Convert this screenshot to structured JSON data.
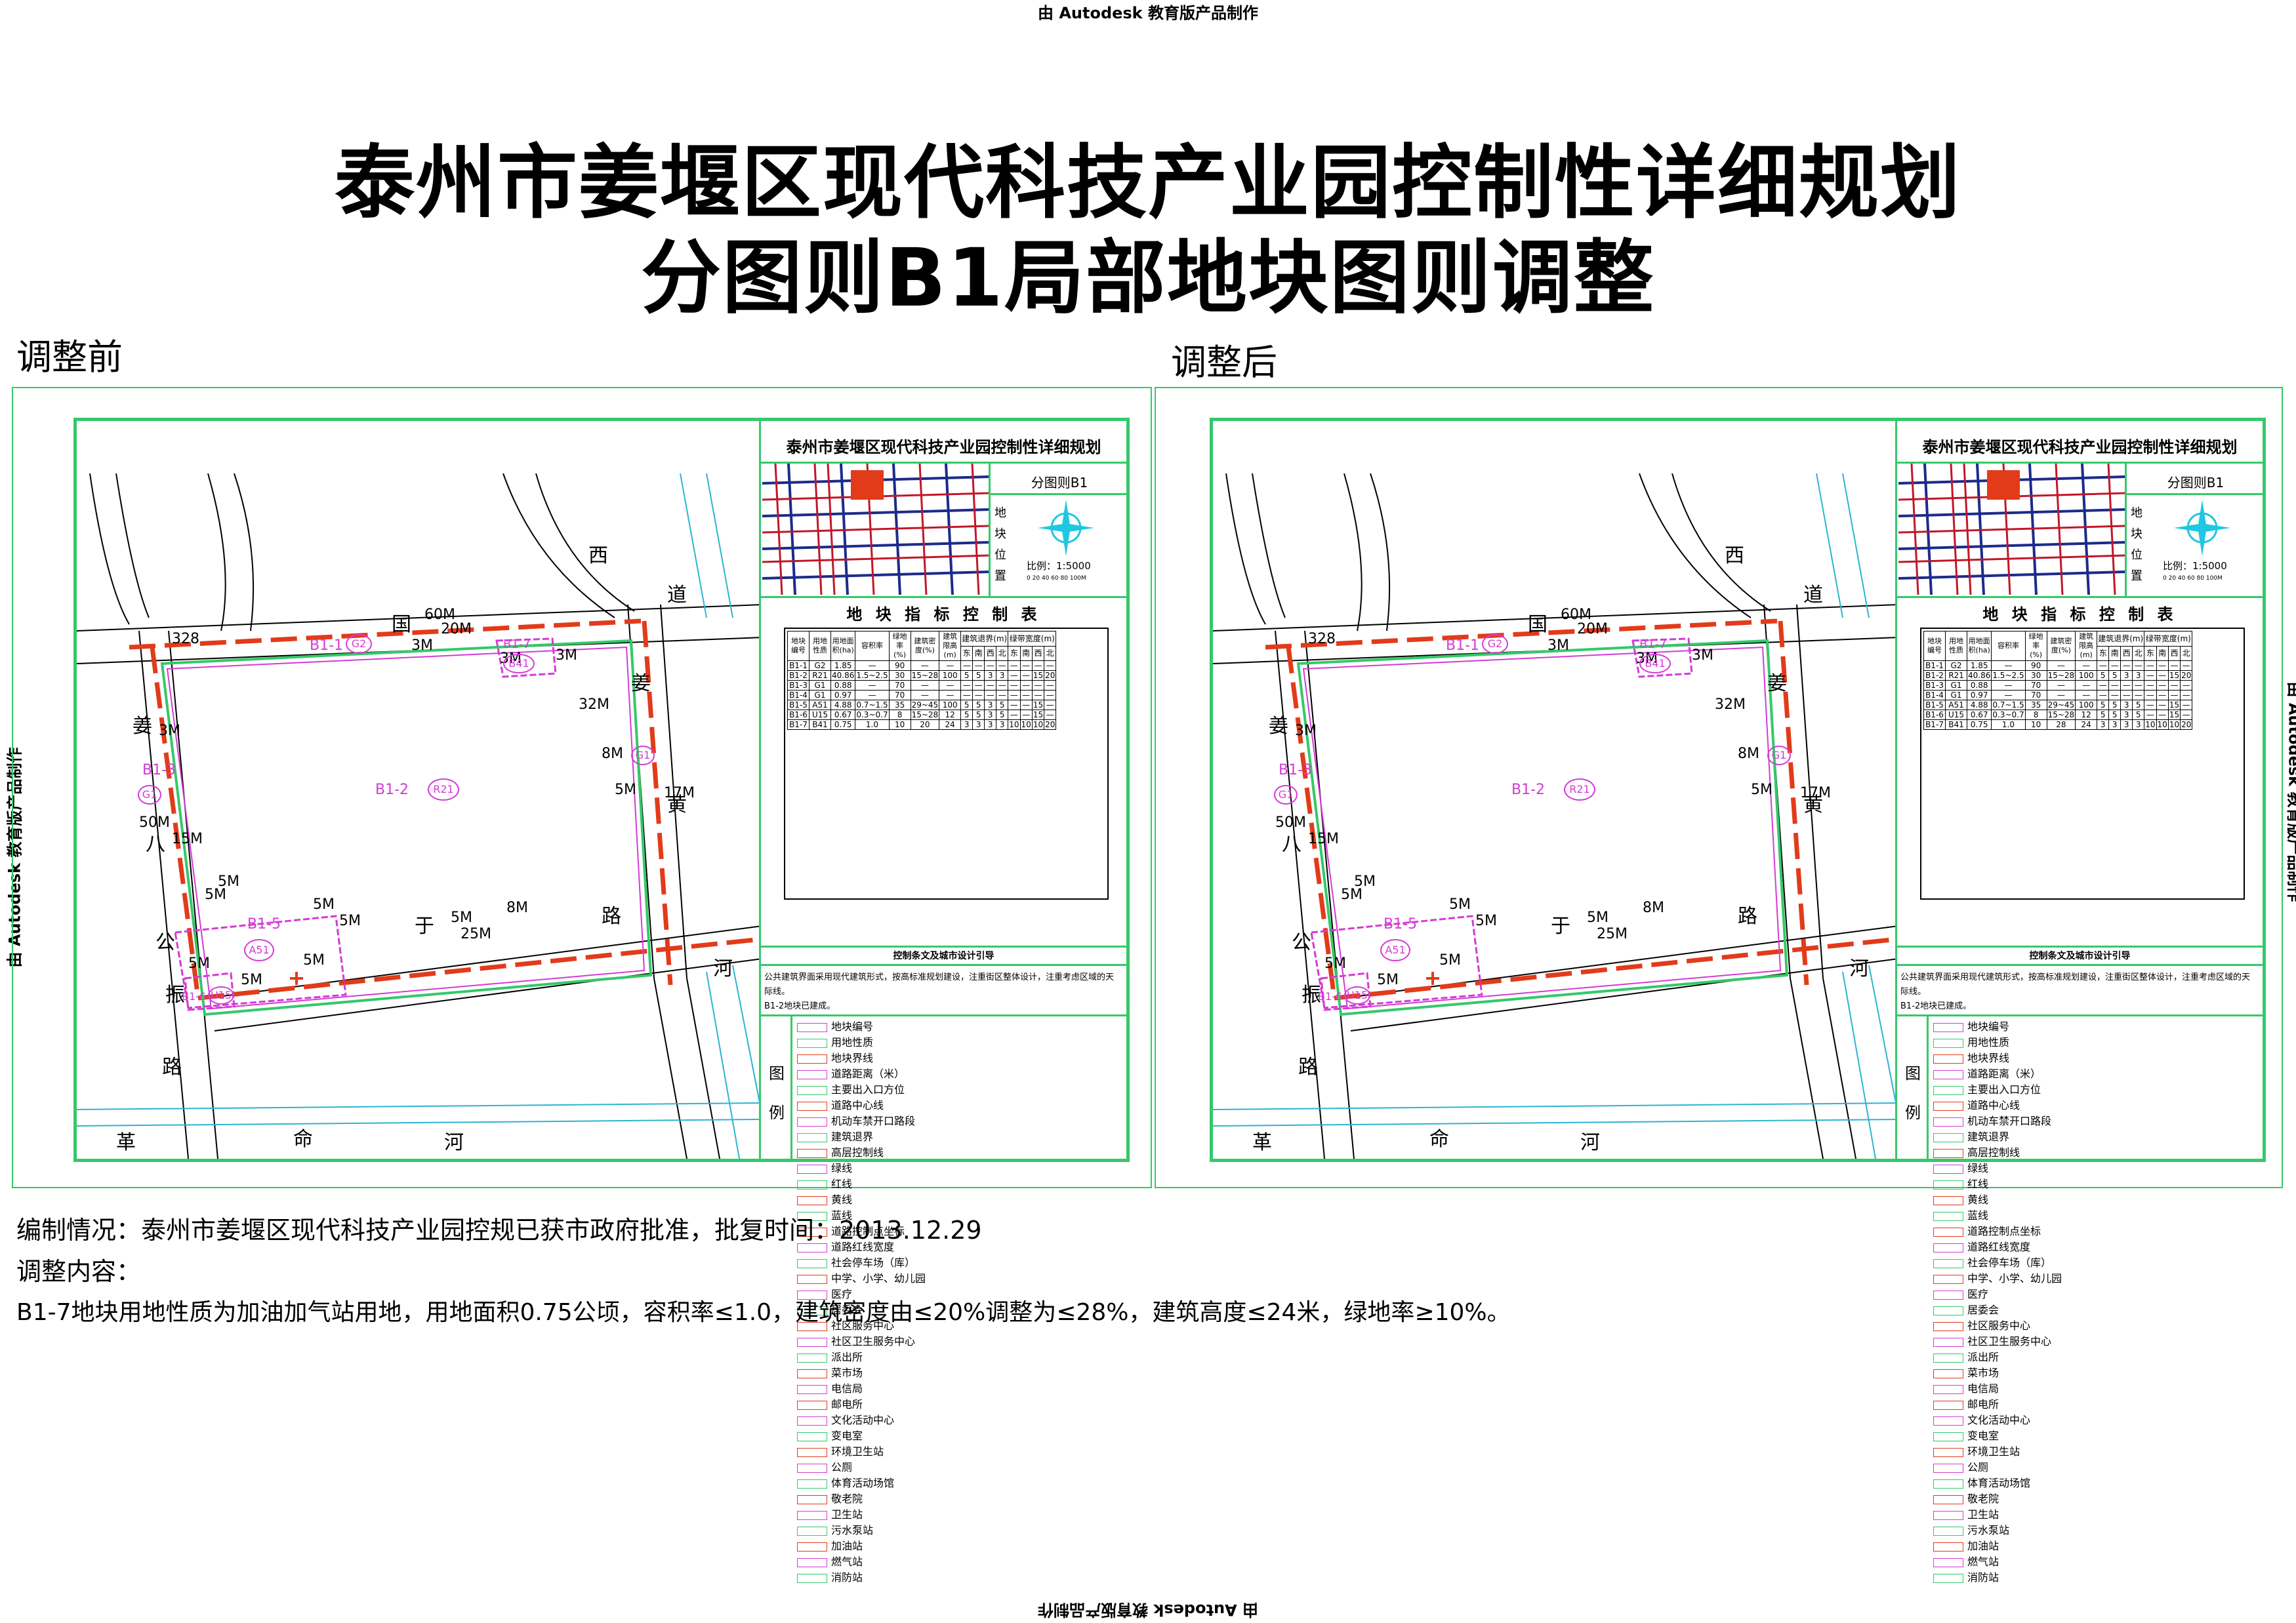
{
  "watermark": "由 Autodesk 教育版产品制作",
  "title_line1": "泰州市姜堰区现代科技产业园控制性详细规划",
  "title_line2": "分图则B1局部地块图则调整",
  "before_label": "调整前",
  "after_label": "调整后",
  "panel": {
    "plan_title": "泰州市姜堰区现代科技产业园控制性详细规划",
    "sheet_name": "分图则B1",
    "location_label": "地块位置",
    "scale": "比例：1:5000",
    "scale_ticks": "0  20  40  60  80  100M",
    "control_table_title": "地 块 指 标 控 制 表",
    "guide_title": "控制条文及城市设计引导",
    "guide_text_1": "公共建筑界面采用现代建筑形式，按高标准规划建设，注重街区整体设计，注重考虑区域的天际线。",
    "guide_text_2": "B1-2地块已建成。",
    "legend_title": "图例"
  },
  "table": {
    "headers": [
      "地块编号",
      "用地性质",
      "用地面积(ha)",
      "容积率",
      "绿地率(%)",
      "建筑密度(%)",
      "建筑限高(m)"
    ],
    "setback_header": "建筑退界(m)",
    "green_header": "绿带宽度(m)",
    "dirs": [
      "东",
      "南",
      "西",
      "北",
      "东",
      "南",
      "西",
      "北"
    ],
    "rows_before": [
      [
        "B1-1",
        "G2",
        "1.85",
        "—",
        "90",
        "—",
        "—",
        "—",
        "—",
        "—",
        "—",
        "—",
        "—",
        "—",
        "—"
      ],
      [
        "B1-2",
        "R21",
        "40.86",
        "1.5~2.5",
        "30",
        "15~28",
        "100",
        "5",
        "5",
        "3",
        "3",
        "—",
        "—",
        "15",
        "20"
      ],
      [
        "B1-3",
        "G1",
        "0.88",
        "—",
        "70",
        "—",
        "—",
        "—",
        "—",
        "—",
        "—",
        "—",
        "—",
        "—",
        "—"
      ],
      [
        "B1-4",
        "G1",
        "0.97",
        "—",
        "70",
        "—",
        "—",
        "—",
        "—",
        "—",
        "—",
        "—",
        "—",
        "—",
        "—"
      ],
      [
        "B1-5",
        "A51",
        "4.88",
        "0.7~1.5",
        "35",
        "29~45",
        "100",
        "5",
        "5",
        "3",
        "5",
        "—",
        "—",
        "15",
        "—"
      ],
      [
        "B1-6",
        "U15",
        "0.67",
        "0.3~0.7",
        "8",
        "15~28",
        "12",
        "5",
        "5",
        "3",
        "5",
        "—",
        "—",
        "15",
        "—"
      ],
      [
        "B1-7",
        "B41",
        "0.75",
        "1.0",
        "10",
        "20",
        "24",
        "3",
        "3",
        "3",
        "3",
        "10",
        "10",
        "10",
        "20"
      ]
    ],
    "rows_after": [
      [
        "B1-1",
        "G2",
        "1.85",
        "—",
        "90",
        "—",
        "—",
        "—",
        "—",
        "—",
        "—",
        "—",
        "—",
        "—",
        "—"
      ],
      [
        "B1-2",
        "R21",
        "40.86",
        "1.5~2.5",
        "30",
        "15~28",
        "100",
        "5",
        "5",
        "3",
        "3",
        "—",
        "—",
        "15",
        "20"
      ],
      [
        "B1-3",
        "G1",
        "0.88",
        "—",
        "70",
        "—",
        "—",
        "—",
        "—",
        "—",
        "—",
        "—",
        "—",
        "—",
        "—"
      ],
      [
        "B1-4",
        "G1",
        "0.97",
        "—",
        "70",
        "—",
        "—",
        "—",
        "—",
        "—",
        "—",
        "—",
        "—",
        "—",
        "—"
      ],
      [
        "B1-5",
        "A51",
        "4.88",
        "0.7~1.5",
        "35",
        "29~45",
        "100",
        "5",
        "5",
        "3",
        "5",
        "—",
        "—",
        "15",
        "—"
      ],
      [
        "B1-6",
        "U15",
        "0.67",
        "0.3~0.7",
        "8",
        "15~28",
        "12",
        "5",
        "5",
        "3",
        "5",
        "—",
        "—",
        "15",
        "—"
      ],
      [
        "B1-7",
        "B41",
        "0.75",
        "1.0",
        "10",
        "28",
        "24",
        "3",
        "3",
        "3",
        "3",
        "10",
        "10",
        "10",
        "20"
      ]
    ]
  },
  "legend": {
    "col1": [
      "地块编号",
      "用地性质",
      "地块界线",
      "道路距离（米）",
      "主要出入口方位",
      "道路中心线",
      "机动车禁开口路段",
      "建筑退界",
      "高层控制线",
      "绿线",
      "红线",
      "黄线"
    ],
    "col2": [
      "蓝线",
      "道路控制点坐标",
      "道路红线宽度",
      "社会停车场（库）",
      "中学、小学、幼儿园",
      "医疗",
      "居委会",
      "社区服务中心",
      "社区卫生服务中心",
      "派出所",
      "菜市场",
      "电信局"
    ],
    "col3": [
      "邮电所",
      "文化活动中心",
      "变电室",
      "环境卫生站",
      "公厕",
      "体育活动场馆",
      "敬老院",
      "卫生站",
      "污水泵站",
      "加油站",
      "燃气站",
      "消防站"
    ]
  },
  "map": {
    "roads": {
      "xi": "西",
      "dao": "道",
      "guo": "国",
      "n328": "328",
      "jiang_r1": "姜",
      "jiang_r2": "黄",
      "lu_r": "路",
      "jiang_l1": "姜",
      "jiang_l2": "八",
      "jiang_l3": "公",
      "jiang_l4": "振",
      "jiang_l5": "路",
      "yu": "于",
      "he_r": "河",
      "ge": "革",
      "ming": "命",
      "he_b": "河"
    },
    "dims": {
      "d60m_top": "60M",
      "d20m": "20M",
      "d3m_a": "3M",
      "d3m_b": "3M",
      "d3m_c": "3M",
      "d3m_d": "3M",
      "d3m_left": "3M",
      "d50m": "50M",
      "d15m_left": "15M",
      "d32m": "32M",
      "d8m_r": "8M",
      "d5m_r": "5M",
      "d17m": "17M",
      "d5m_a": "5M",
      "d5m_b": "5M",
      "d5m_c": "5M",
      "d5m_d": "5M",
      "d5m_e": "5M",
      "d5m_f": "5M",
      "d8m_b": "8M",
      "d5m_g": "5M",
      "d25m": "25M",
      "d5m_h": "5M",
      "d5m_i": "5M"
    },
    "parcels": {
      "b1_1": "B1-1",
      "g2": "G2",
      "b1_7": "B1-7",
      "b41": "B41",
      "b1_2": "B1-2",
      "r21": "R21",
      "b1_3": "B1-3",
      "g1_l": "G1",
      "g1_r": "G1",
      "b1_5": "B1-5",
      "a51": "A51",
      "b1_6": "B1-6",
      "u15": "U15"
    }
  },
  "notes": {
    "line1": "编制情况：泰州市姜堰区现代科技产业园控规已获市政府批准，批复时间：2013.12.29",
    "line2": "调整内容：",
    "line3": "B1-7地块用地性质为加油加气站用地，用地面积0.75公顷，容积率≤1.0，建筑密度由≤20%调整为≤28%，建筑高度≤24米，绿地率≥10%。"
  },
  "colors": {
    "frame_green": "#35c86a",
    "road_red": "#e23b1a",
    "parcel_magenta": "#d43bd6",
    "compass_cyan": "#1ec8e0",
    "water_cyan": "#2ab5d0"
  }
}
